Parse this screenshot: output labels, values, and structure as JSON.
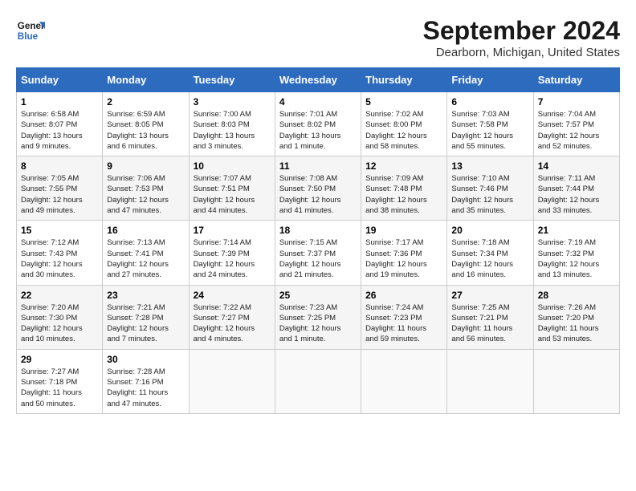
{
  "header": {
    "logo_line1": "General",
    "logo_line2": "Blue",
    "title": "September 2024",
    "subtitle": "Dearborn, Michigan, United States"
  },
  "columns": [
    "Sunday",
    "Monday",
    "Tuesday",
    "Wednesday",
    "Thursday",
    "Friday",
    "Saturday"
  ],
  "weeks": [
    [
      {
        "day": "1",
        "info": "Sunrise: 6:58 AM\nSunset: 8:07 PM\nDaylight: 13 hours\nand 9 minutes."
      },
      {
        "day": "2",
        "info": "Sunrise: 6:59 AM\nSunset: 8:05 PM\nDaylight: 13 hours\nand 6 minutes."
      },
      {
        "day": "3",
        "info": "Sunrise: 7:00 AM\nSunset: 8:03 PM\nDaylight: 13 hours\nand 3 minutes."
      },
      {
        "day": "4",
        "info": "Sunrise: 7:01 AM\nSunset: 8:02 PM\nDaylight: 13 hours\nand 1 minute."
      },
      {
        "day": "5",
        "info": "Sunrise: 7:02 AM\nSunset: 8:00 PM\nDaylight: 12 hours\nand 58 minutes."
      },
      {
        "day": "6",
        "info": "Sunrise: 7:03 AM\nSunset: 7:58 PM\nDaylight: 12 hours\nand 55 minutes."
      },
      {
        "day": "7",
        "info": "Sunrise: 7:04 AM\nSunset: 7:57 PM\nDaylight: 12 hours\nand 52 minutes."
      }
    ],
    [
      {
        "day": "8",
        "info": "Sunrise: 7:05 AM\nSunset: 7:55 PM\nDaylight: 12 hours\nand 49 minutes."
      },
      {
        "day": "9",
        "info": "Sunrise: 7:06 AM\nSunset: 7:53 PM\nDaylight: 12 hours\nand 47 minutes."
      },
      {
        "day": "10",
        "info": "Sunrise: 7:07 AM\nSunset: 7:51 PM\nDaylight: 12 hours\nand 44 minutes."
      },
      {
        "day": "11",
        "info": "Sunrise: 7:08 AM\nSunset: 7:50 PM\nDaylight: 12 hours\nand 41 minutes."
      },
      {
        "day": "12",
        "info": "Sunrise: 7:09 AM\nSunset: 7:48 PM\nDaylight: 12 hours\nand 38 minutes."
      },
      {
        "day": "13",
        "info": "Sunrise: 7:10 AM\nSunset: 7:46 PM\nDaylight: 12 hours\nand 35 minutes."
      },
      {
        "day": "14",
        "info": "Sunrise: 7:11 AM\nSunset: 7:44 PM\nDaylight: 12 hours\nand 33 minutes."
      }
    ],
    [
      {
        "day": "15",
        "info": "Sunrise: 7:12 AM\nSunset: 7:43 PM\nDaylight: 12 hours\nand 30 minutes."
      },
      {
        "day": "16",
        "info": "Sunrise: 7:13 AM\nSunset: 7:41 PM\nDaylight: 12 hours\nand 27 minutes."
      },
      {
        "day": "17",
        "info": "Sunrise: 7:14 AM\nSunset: 7:39 PM\nDaylight: 12 hours\nand 24 minutes."
      },
      {
        "day": "18",
        "info": "Sunrise: 7:15 AM\nSunset: 7:37 PM\nDaylight: 12 hours\nand 21 minutes."
      },
      {
        "day": "19",
        "info": "Sunrise: 7:17 AM\nSunset: 7:36 PM\nDaylight: 12 hours\nand 19 minutes."
      },
      {
        "day": "20",
        "info": "Sunrise: 7:18 AM\nSunset: 7:34 PM\nDaylight: 12 hours\nand 16 minutes."
      },
      {
        "day": "21",
        "info": "Sunrise: 7:19 AM\nSunset: 7:32 PM\nDaylight: 12 hours\nand 13 minutes."
      }
    ],
    [
      {
        "day": "22",
        "info": "Sunrise: 7:20 AM\nSunset: 7:30 PM\nDaylight: 12 hours\nand 10 minutes."
      },
      {
        "day": "23",
        "info": "Sunrise: 7:21 AM\nSunset: 7:28 PM\nDaylight: 12 hours\nand 7 minutes."
      },
      {
        "day": "24",
        "info": "Sunrise: 7:22 AM\nSunset: 7:27 PM\nDaylight: 12 hours\nand 4 minutes."
      },
      {
        "day": "25",
        "info": "Sunrise: 7:23 AM\nSunset: 7:25 PM\nDaylight: 12 hours\nand 1 minute."
      },
      {
        "day": "26",
        "info": "Sunrise: 7:24 AM\nSunset: 7:23 PM\nDaylight: 11 hours\nand 59 minutes."
      },
      {
        "day": "27",
        "info": "Sunrise: 7:25 AM\nSunset: 7:21 PM\nDaylight: 11 hours\nand 56 minutes."
      },
      {
        "day": "28",
        "info": "Sunrise: 7:26 AM\nSunset: 7:20 PM\nDaylight: 11 hours\nand 53 minutes."
      }
    ],
    [
      {
        "day": "29",
        "info": "Sunrise: 7:27 AM\nSunset: 7:18 PM\nDaylight: 11 hours\nand 50 minutes."
      },
      {
        "day": "30",
        "info": "Sunrise: 7:28 AM\nSunset: 7:16 PM\nDaylight: 11 hours\nand 47 minutes."
      },
      {
        "day": "",
        "info": ""
      },
      {
        "day": "",
        "info": ""
      },
      {
        "day": "",
        "info": ""
      },
      {
        "day": "",
        "info": ""
      },
      {
        "day": "",
        "info": ""
      }
    ]
  ]
}
